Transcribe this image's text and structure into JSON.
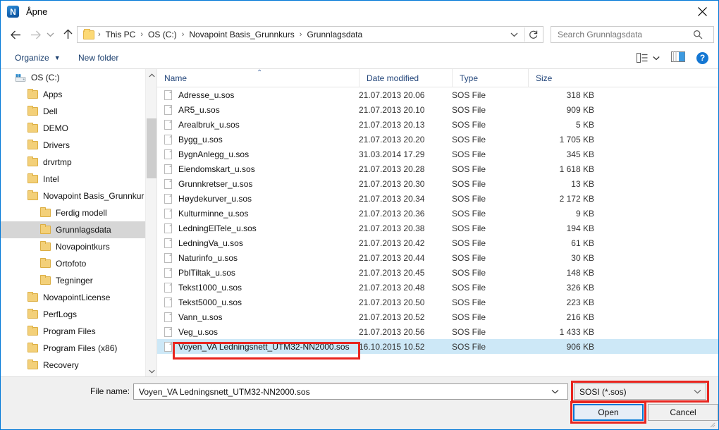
{
  "window": {
    "title": "Åpne",
    "app_icon_letter": "N",
    "close_label": "×"
  },
  "nav": {
    "back_icon": "arrow-left-icon",
    "forward_icon": "arrow-right-icon",
    "recent_icon": "chevron-down-icon",
    "up_icon": "arrow-up-icon",
    "breadcrumbs": [
      "This PC",
      "OS (C:)",
      "Novapoint Basis_Grunnkurs",
      "Grunnlagsdata"
    ],
    "separator": "›",
    "refresh_icon": "refresh-icon"
  },
  "search": {
    "placeholder": "Search Grunnlagsdata",
    "value": "",
    "icon": "search-icon"
  },
  "toolbar": {
    "organize_label": "Organize",
    "new_folder_label": "New folder",
    "caret": "▼",
    "view_icon": "view-list-icon",
    "layout_icon": "preview-pane-icon",
    "help_label": "?"
  },
  "tree": {
    "items": [
      {
        "label": "OS (C:)",
        "indent": 0,
        "icon": "drive-icon",
        "selected": false
      },
      {
        "label": "Apps",
        "indent": 1,
        "icon": "folder-icon",
        "selected": false
      },
      {
        "label": "Dell",
        "indent": 1,
        "icon": "folder-icon",
        "selected": false
      },
      {
        "label": "DEMO",
        "indent": 1,
        "icon": "folder-icon",
        "selected": false
      },
      {
        "label": "Drivers",
        "indent": 1,
        "icon": "folder-icon",
        "selected": false
      },
      {
        "label": "drvrtmp",
        "indent": 1,
        "icon": "folder-icon",
        "selected": false
      },
      {
        "label": "Intel",
        "indent": 1,
        "icon": "folder-icon",
        "selected": false
      },
      {
        "label": "Novapoint Basis_Grunnkur",
        "indent": 1,
        "icon": "folder-icon",
        "selected": false
      },
      {
        "label": "Ferdig modell",
        "indent": 2,
        "icon": "folder-icon",
        "selected": false
      },
      {
        "label": "Grunnlagsdata",
        "indent": 2,
        "icon": "folder-icon",
        "selected": true
      },
      {
        "label": "Novapointkurs",
        "indent": 2,
        "icon": "folder-icon",
        "selected": false
      },
      {
        "label": "Ortofoto",
        "indent": 2,
        "icon": "folder-icon",
        "selected": false
      },
      {
        "label": "Tegninger",
        "indent": 2,
        "icon": "folder-icon",
        "selected": false
      },
      {
        "label": "NovapointLicense",
        "indent": 1,
        "icon": "folder-icon",
        "selected": false
      },
      {
        "label": "PerfLogs",
        "indent": 1,
        "icon": "folder-icon",
        "selected": false
      },
      {
        "label": "Program Files",
        "indent": 1,
        "icon": "folder-icon",
        "selected": false
      },
      {
        "label": "Program Files (x86)",
        "indent": 1,
        "icon": "folder-icon",
        "selected": false
      },
      {
        "label": "Recovery",
        "indent": 1,
        "icon": "folder-icon",
        "selected": false
      }
    ],
    "scroll_up_icon": "chevron-up-icon",
    "scroll_down_icon": "chevron-down-icon"
  },
  "list": {
    "columns": [
      "Name",
      "Date modified",
      "Type",
      "Size"
    ],
    "sort_column": "Name",
    "sort_indicator": "⌃",
    "rows": [
      {
        "name": "Adresse_u.sos",
        "date": "21.07.2013 20.06",
        "type": "SOS File",
        "size": "318 KB",
        "selected": false
      },
      {
        "name": "AR5_u.sos",
        "date": "21.07.2013 20.10",
        "type": "SOS File",
        "size": "909 KB",
        "selected": false
      },
      {
        "name": "Arealbruk_u.sos",
        "date": "21.07.2013 20.13",
        "type": "SOS File",
        "size": "5 KB",
        "selected": false
      },
      {
        "name": "Bygg_u.sos",
        "date": "21.07.2013 20.20",
        "type": "SOS File",
        "size": "1 705 KB",
        "selected": false
      },
      {
        "name": "BygnAnlegg_u.sos",
        "date": "31.03.2014 17.29",
        "type": "SOS File",
        "size": "345 KB",
        "selected": false
      },
      {
        "name": "Eiendomskart_u.sos",
        "date": "21.07.2013 20.28",
        "type": "SOS File",
        "size": "1 618 KB",
        "selected": false
      },
      {
        "name": "Grunnkretser_u.sos",
        "date": "21.07.2013 20.30",
        "type": "SOS File",
        "size": "13 KB",
        "selected": false
      },
      {
        "name": "Høydekurver_u.sos",
        "date": "21.07.2013 20.34",
        "type": "SOS File",
        "size": "2 172 KB",
        "selected": false
      },
      {
        "name": "Kulturminne_u.sos",
        "date": "21.07.2013 20.36",
        "type": "SOS File",
        "size": "9 KB",
        "selected": false
      },
      {
        "name": "LedningElTele_u.sos",
        "date": "21.07.2013 20.38",
        "type": "SOS File",
        "size": "194 KB",
        "selected": false
      },
      {
        "name": "LedningVa_u.sos",
        "date": "21.07.2013 20.42",
        "type": "SOS File",
        "size": "61 KB",
        "selected": false
      },
      {
        "name": "Naturinfo_u.sos",
        "date": "21.07.2013 20.44",
        "type": "SOS File",
        "size": "30 KB",
        "selected": false
      },
      {
        "name": "PblTiltak_u.sos",
        "date": "21.07.2013 20.45",
        "type": "SOS File",
        "size": "148 KB",
        "selected": false
      },
      {
        "name": "Tekst1000_u.sos",
        "date": "21.07.2013 20.48",
        "type": "SOS File",
        "size": "326 KB",
        "selected": false
      },
      {
        "name": "Tekst5000_u.sos",
        "date": "21.07.2013 20.50",
        "type": "SOS File",
        "size": "223 KB",
        "selected": false
      },
      {
        "name": "Vann_u.sos",
        "date": "21.07.2013 20.52",
        "type": "SOS File",
        "size": "216 KB",
        "selected": false
      },
      {
        "name": "Veg_u.sos",
        "date": "21.07.2013 20.56",
        "type": "SOS File",
        "size": "1 433 KB",
        "selected": false
      },
      {
        "name": "Voyen_VA Ledningsnett_UTM32-NN2000.sos",
        "date": "16.10.2015 10.52",
        "type": "SOS File",
        "size": "906 KB",
        "selected": true
      }
    ]
  },
  "footer": {
    "filename_label": "File name:",
    "filename_value": "Voyen_VA Ledningsnett_UTM32-NN2000.sos",
    "filetype_value": "SOSI (*.sos)",
    "open_label": "Open",
    "cancel_label": "Cancel"
  },
  "colors": {
    "accent": "#0078d7",
    "selection": "#cde8f7",
    "annotation": "#e8251f",
    "tree_selection": "#d6d6d6"
  }
}
